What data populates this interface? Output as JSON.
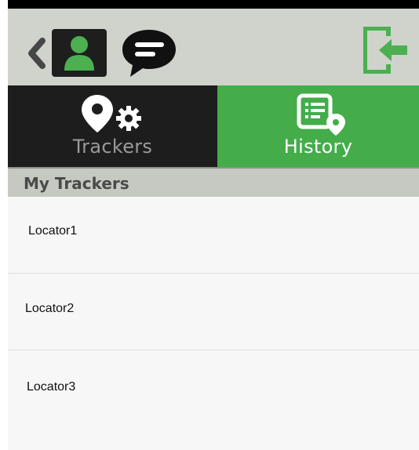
{
  "topbar": {
    "icons": [
      "chevron-left-icon",
      "user-profile-icon",
      "chat-bubble-icon",
      "logout-icon"
    ],
    "accent_color": "#44ad4a",
    "background_color": "#cfd3cc"
  },
  "tabs": [
    {
      "label": "Trackers",
      "icon": "location-settings-icon",
      "active": false
    },
    {
      "label": "History",
      "icon": "history-list-icon",
      "active": true
    }
  ],
  "section": {
    "title": "My Trackers"
  },
  "trackers": [
    {
      "name": "Locator1"
    },
    {
      "name": "Locator2"
    },
    {
      "name": "Locator3"
    }
  ]
}
